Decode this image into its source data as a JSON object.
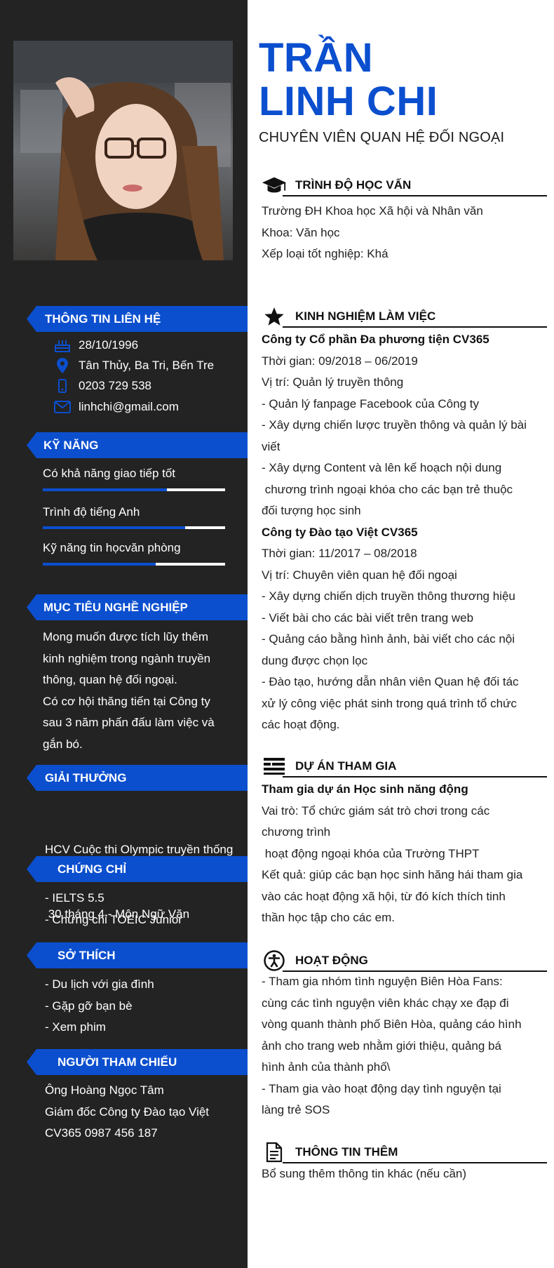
{
  "profile": {
    "name_line1": "TRẦN",
    "name_line2": "LINH CHI",
    "job_title": "CHUYÊN VIÊN QUAN HỆ ĐỐI NGOẠI"
  },
  "colors": {
    "accent": "#0b4fcf",
    "sidebar": "#232323"
  },
  "contact": {
    "heading": "THÔNG TIN LIÊN HỆ",
    "birthday": "28/10/1996",
    "address": "Tân Thủy, Ba Tri, Bến Tre",
    "phone": "0203 729 538",
    "email": "linhchi@gmail.com"
  },
  "skills": {
    "heading": "KỸ NĂNG",
    "items": [
      {
        "label": "Có khả năng giao tiếp tốt",
        "level": 0.68
      },
      {
        "label": "Trình độ tiếng Anh",
        "level": 0.78
      },
      {
        "label": "Kỹ năng tin họcvăn phòng",
        "level": 0.62
      }
    ]
  },
  "objective": {
    "heading": "MỤC TIÊU NGHỀ NGHIỆP",
    "lines": [
      "Mong muốn được tích lũy thêm",
      "kinh nghiệm trong ngành truyền",
      "thông, quan hệ đối ngoại.",
      "Có cơ hội thăng tiến tại Công ty",
      "sau 3 năm phấn đấu làm việc và",
      "gắn bó."
    ]
  },
  "awards": {
    "heading": "GIẢI THƯỞNG",
    "lines": [
      "HCV Cuộc thi Olympic truyền thống",
      " 30 tháng 4 - Môn Ngữ Văn"
    ]
  },
  "certificates": {
    "heading": "CHỨNG CHỈ",
    "lines": [
      "- IELTS 5.5",
      "- Chứng chỉ TOEIC Junior"
    ]
  },
  "hobbies": {
    "heading": "SỞ THÍCH",
    "lines": [
      "- Du lịch với gia đình",
      "- Gặp gỡ bạn bè",
      "- Xem phim"
    ]
  },
  "references": {
    "heading": "NGƯỜI THAM CHIẾU",
    "lines": [
      "Ông Hoàng Ngọc Tâm",
      "Giám đốc Công ty Đào tạo Việt",
      "CV365 0987 456 187"
    ]
  },
  "education": {
    "heading": "TRÌNH ĐỘ HỌC VẤN",
    "icon": "graduation-cap-icon",
    "lines": [
      "Trường ĐH Khoa học Xã hội và Nhân văn",
      "Khoa: Văn học",
      "Xếp loại tốt nghiệp: Khá"
    ]
  },
  "experience": {
    "heading": "KINH NGHIỆM LÀM VIỆC",
    "icon": "star-icon",
    "lines": [
      "Công ty Cổ phần Đa phương tiện CV365",
      "Thời gian: 09/2018 – 06/2019",
      "Vị trí: Quản lý truyền thông",
      "- Quản lý fanpage Facebook của Công ty",
      "- Xây dựng chiến lược truyền thông và quản lý bài",
      "viết",
      "- Xây dựng Content và lên kế hoạch nội dung",
      " chương trình ngoại khóa cho các bạn trẻ thuộc",
      "đối tượng học sinh",
      "Công ty Đào tạo Việt CV365",
      "Thời gian: 11/2017 – 08/2018",
      "Vị trí: Chuyên viên quan hệ đối ngoại",
      "- Xây dựng chiến dịch truyền thông thương hiệu",
      "- Viết bài cho các bài viết trên trang web",
      "- Quảng cáo bằng hình ảnh, bài viết cho các nội",
      "dung được chọn lọc",
      "- Đào tạo, hướng dẫn nhân viên Quan hệ đối tác",
      "xử lý công việc phát sinh trong quá trình tổ chức",
      "các hoạt động."
    ]
  },
  "projects": {
    "heading": "DỰ ÁN THAM GIA",
    "icon": "list-icon",
    "lines": [
      "Tham gia dự án Học sinh năng động",
      "Vai trò: Tổ chức giám sát trò chơi trong các",
      "chương trình",
      " hoạt động ngoại khóa của Trường THPT",
      "Kết quả: giúp các bạn học sinh hăng hái tham gia",
      "vào các hoạt động xã hội, từ đó kích thích tinh",
      "thần học tập cho các em."
    ]
  },
  "activities": {
    "heading": "HOẠT ĐỘNG",
    "icon": "accessibility-icon",
    "lines": [
      "- Tham gia nhóm tình nguyện Biên Hòa Fans:",
      "cùng các tình nguyện viên khác chạy xe đạp đi",
      "vòng quanh thành phố Biên Hòa, quảng cáo hình",
      "ảnh cho trang web nhằm giới thiệu, quảng bá",
      "hình ảnh của thành phố\\",
      "- Tham gia vào hoạt động dạy tình nguyện tại",
      "làng trẻ SOS"
    ]
  },
  "additional": {
    "heading": "THÔNG TIN THÊM",
    "icon": "document-icon",
    "lines": [
      "Bổ sung thêm thông tin khác (nếu cần)"
    ]
  }
}
